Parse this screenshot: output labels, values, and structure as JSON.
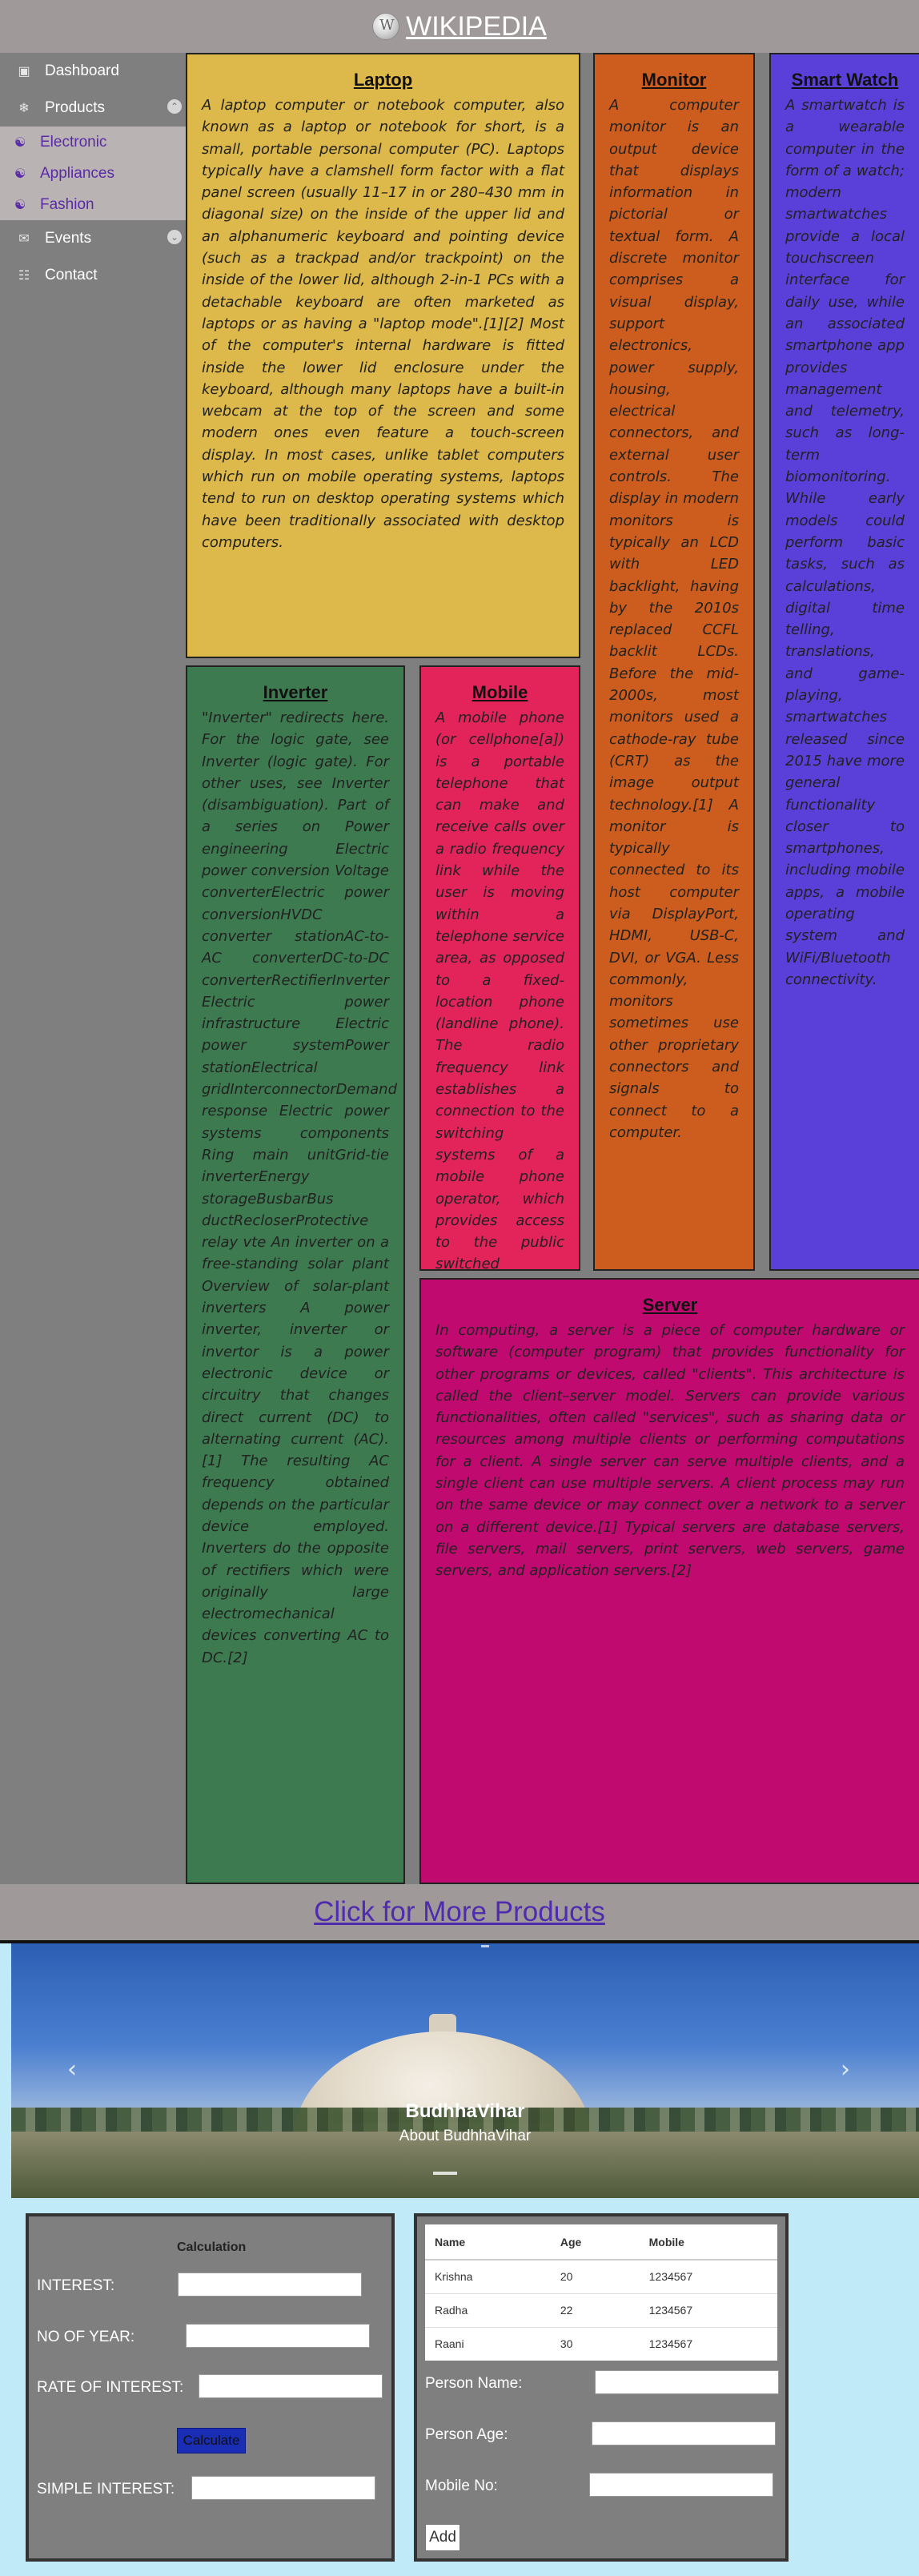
{
  "header": {
    "title": "WIKIPEDIA"
  },
  "sidebar": {
    "items": [
      {
        "label": "Dashboard",
        "icon": "dashboard-icon"
      },
      {
        "label": "Products",
        "icon": "snowflake-icon"
      },
      {
        "label": "Events",
        "icon": "envelope-icon"
      },
      {
        "label": "Contact",
        "icon": "contact-card-icon"
      }
    ],
    "sub_items": [
      {
        "label": "Electronic",
        "icon": "basket-icon"
      },
      {
        "label": "Appliances",
        "icon": "basket-icon"
      },
      {
        "label": "Fashion",
        "icon": "basket-icon"
      }
    ]
  },
  "cards": {
    "laptop": {
      "title": "Laptop",
      "text": "A laptop computer or notebook computer, also known as a laptop or notebook for short, is a small, portable personal computer (PC). Laptops typically have a clamshell form factor with a flat panel screen (usually 11–17 in or 280–430 mm in diagonal size) on the inside of the upper lid and an alphanumeric keyboard and pointing device (such as a trackpad and/or trackpoint) on the inside of the lower lid, although 2-in-1 PCs with a detachable keyboard are often marketed as laptops or as having a \"laptop mode\".[1][2] Most of the computer's internal hardware is fitted inside the lower lid enclosure under the keyboard, although many laptops have a built-in webcam at the top of the screen and some modern ones even feature a touch-screen display. In most cases, unlike tablet computers which run on mobile operating systems, laptops tend to run on desktop operating systems which have been traditionally associated with desktop computers."
    },
    "monitor": {
      "title": "Monitor",
      "text": "A computer monitor is an output device that displays information in pictorial or textual form. A discrete monitor comprises a visual display, support electronics, power supply, housing, electrical connectors, and external user controls. The display in modern monitors is typically an LCD with LED backlight, having by the 2010s replaced CCFL backlit LCDs. Before the mid-2000s, most monitors used a cathode-ray tube (CRT) as the image output technology.[1] A monitor is typically connected to its host computer via DisplayPort, HDMI, USB-C, DVI, or VGA. Less commonly, monitors sometimes use other proprietary connectors and signals to connect to a computer."
    },
    "smartwatch": {
      "title": "Smart Watch",
      "text": "A smartwatch is a wearable computer in the form of a watch; modern smartwatches provide a local touchscreen interface for daily use, while an associated smartphone app provides management and telemetry, such as long-term biomonitoring. While early models could perform basic tasks, such as calculations, digital time telling, translations, and game-playing, smartwatches released since 2015 have more general functionality closer to smartphones, including mobile apps, a mobile operating system and WiFi/Bluetooth connectivity."
    },
    "inverter": {
      "title": "Inverter",
      "text": "\"Inverter\" redirects here. For the logic gate, see Inverter (logic gate). For other uses, see Inverter (disambiguation). Part of a series on Power engineering Electric power conversion Voltage converterElectric power conversionHVDC converter stationAC-to-AC converterDC-to-DC converterRectifierInverter Electric power infrastructure Electric power systemPower stationElectrical gridInterconnectorDemand response Electric power systems components Ring main unitGrid-tie inverterEnergy storageBusbarBus ductRecloserProtective relay vte An inverter on a free-standing solar plant Overview of solar-plant inverters A power inverter, inverter or invertor is a power electronic device or circuitry that changes direct current (DC) to alternating current (AC).[1] The resulting AC frequency obtained depends on the particular device employed. Inverters do the opposite of rectifiers which were originally large electromechanical devices converting AC to DC.[2]"
    },
    "mobile": {
      "title": "Mobile",
      "text": "A mobile phone (or cellphone[a]) is a portable telephone that can make and receive calls over a radio frequency link while the user is moving within a telephone service area, as opposed to a fixed-location phone (landline phone). The radio frequency link establishes a connection to the switching systems of a mobile phone operator, which provides access to the public switched telephone network (PSTN)."
    },
    "server": {
      "title": "Server",
      "text": "In computing, a server is a piece of computer hardware or software (computer program) that provides functionality for other programs or devices, called \"clients\". This architecture is called the client–server model. Servers can provide various functionalities, often called \"services\", such as sharing data or resources among multiple clients or performing computations for a client. A single server can serve multiple clients, and a single client can use multiple servers. A client process may run on the same device or may connect over a network to a server on a different device.[1] Typical servers are database servers, file servers, mail servers, print servers, web servers, game servers, and application servers.[2]"
    }
  },
  "more_products": {
    "label": "Click for More Products"
  },
  "carousel": {
    "title": "BudhhaVihar",
    "subtitle": "About BudhhaVihar",
    "prev_icon": "chevron-left-icon",
    "next_icon": "chevron-right-icon"
  },
  "calculator": {
    "title": "Calculation",
    "interest_label": "INTEREST:",
    "years_label": "NO OF YEAR:",
    "rate_label": "RATE OF INTEREST:",
    "calculate_label": "Calculate",
    "simple_interest_label": "SIMPLE INTEREST:",
    "interest_value": "",
    "years_value": "",
    "rate_value": "",
    "simple_interest_value": ""
  },
  "persons": {
    "columns": [
      "Name",
      "Age",
      "Mobile"
    ],
    "rows": [
      [
        "Krishna",
        "20",
        "1234567"
      ],
      [
        "Radha",
        "22",
        "1234567"
      ],
      [
        "Raani",
        "30",
        "1234567"
      ]
    ],
    "name_label": "Person Name:",
    "age_label": "Person Age:",
    "mobile_label": "Mobile No:",
    "add_label": "Add"
  },
  "colors": {
    "header": "#a09999",
    "laptop": "#ddb84a",
    "monitor": "#cc5d1e",
    "smartwatch": "#5a40d8",
    "inverter": "#3d7a50",
    "mobile": "#e2245a",
    "server": "#c00a6f",
    "page_bottom": "#c0eaf8"
  }
}
